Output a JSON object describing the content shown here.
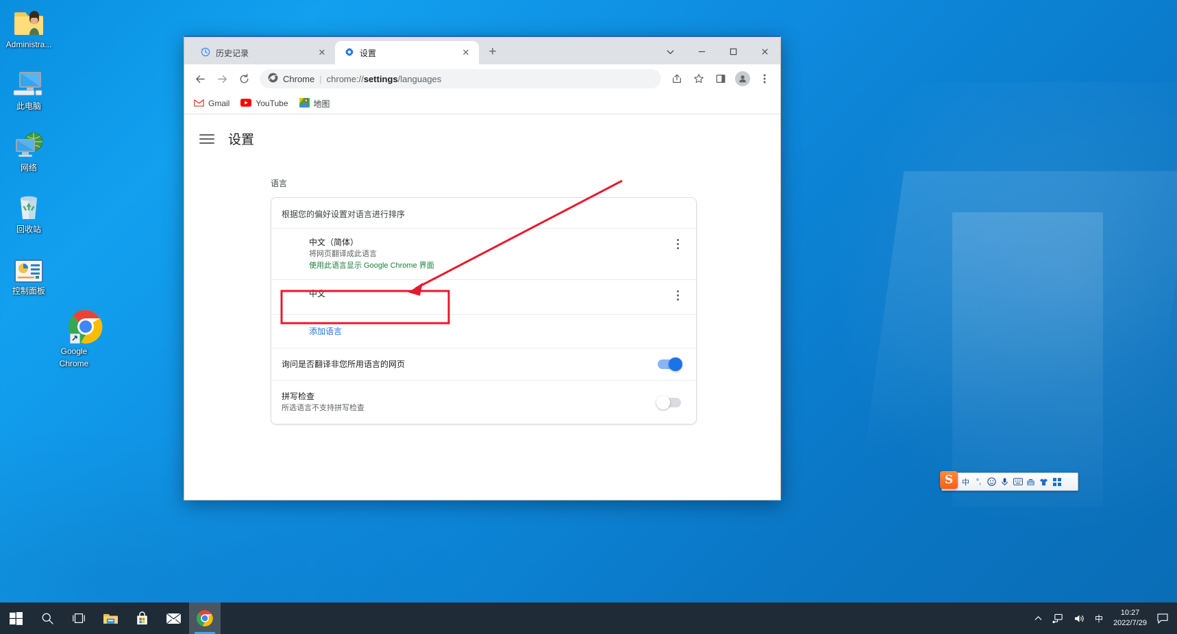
{
  "desktop": {
    "icons": [
      {
        "name": "administrator-folder",
        "label": "Administra..."
      },
      {
        "name": "this-pc",
        "label": "此电脑"
      },
      {
        "name": "network",
        "label": "网络"
      },
      {
        "name": "recycle-bin",
        "label": "回收站"
      },
      {
        "name": "control-panel",
        "label": "控制面板"
      },
      {
        "name": "google-chrome",
        "label": "Google\nChrome",
        "label_line1": "Google",
        "label_line2": "Chrome"
      }
    ]
  },
  "browser": {
    "tabs": [
      {
        "title": "历史记录",
        "icon": "history-icon",
        "active": false,
        "close_label": "✕"
      },
      {
        "title": "设置",
        "icon": "gear-icon",
        "active": true,
        "close_label": "✕"
      }
    ],
    "new_tab_label": "+",
    "window_controls": {
      "tab_search": "tab-search-icon",
      "minimize": "minimize-icon",
      "maximize": "maximize-icon",
      "close": "close-icon"
    },
    "nav": {
      "back": "back-arrow-icon",
      "forward": "forward-arrow-icon",
      "reload": "reload-icon"
    },
    "omnibox": {
      "product": "Chrome",
      "separator": "|",
      "url_prefix": "chrome://",
      "url_bold": "settings",
      "url_suffix": "/languages",
      "full_url": "chrome://settings/languages"
    },
    "toolbar_icons": [
      "share-icon",
      "bookmark-star-icon",
      "side-panel-icon",
      "profile-avatar-icon",
      "chrome-menu-icon"
    ],
    "bookmarks": [
      {
        "label": "Gmail",
        "icon": "gmail-icon"
      },
      {
        "label": "YouTube",
        "icon": "youtube-icon"
      },
      {
        "label": "地图",
        "icon": "maps-icon"
      }
    ]
  },
  "settings": {
    "page_title": "设置",
    "menu_icon": "hamburger-menu-icon",
    "section_label": "语言",
    "card": {
      "heading": "根据您的偏好设置对语言进行排序",
      "languages": [
        {
          "name": "中文（简体）",
          "sub1": "将网页翻译成此语言",
          "sub2": "使用此语言显示 Google Chrome 界面",
          "menu": "more-options-icon"
        },
        {
          "name": "中文",
          "sub1": "",
          "sub2": "",
          "menu": "more-options-icon"
        }
      ],
      "add_language": "添加语言",
      "translate_pref": {
        "title": "询问是否翻译非您所用语言的网页",
        "toggle": "on"
      },
      "spellcheck": {
        "title": "拼写检查",
        "sub": "所选语言不支持拼写检查",
        "toggle": "off"
      }
    }
  },
  "annotation": {
    "color": "#e8192c",
    "highlight_target": "添加语言",
    "shape": "arrow-to-highlight-box"
  },
  "taskbar": {
    "items": [
      {
        "name": "start-button",
        "icon": "windows-logo-icon"
      },
      {
        "name": "search-button",
        "icon": "search-icon"
      },
      {
        "name": "task-view-button",
        "icon": "task-view-icon"
      },
      {
        "name": "file-explorer-button",
        "icon": "folder-icon"
      },
      {
        "name": "microsoft-store-button",
        "icon": "store-bag-icon"
      },
      {
        "name": "mail-button",
        "icon": "envelope-icon"
      },
      {
        "name": "chrome-taskbar-button",
        "icon": "chrome-icon",
        "active": true
      }
    ],
    "tray": {
      "expand": "chevron-up-icon",
      "network": "network-icon",
      "volume": "volume-icon",
      "ime": "中",
      "time": "10:27",
      "date": "2022/7/29",
      "notifications": "notification-icon"
    }
  },
  "ime_bar": {
    "logo": "S",
    "items": [
      {
        "name": "ime-mode",
        "label": "中"
      },
      {
        "name": "ime-punctuation",
        "label": "°,"
      },
      {
        "name": "ime-emoji",
        "label": "☺"
      },
      {
        "name": "ime-voice",
        "label": "🎤"
      },
      {
        "name": "ime-keyboard",
        "label": "⌨"
      },
      {
        "name": "ime-toolbox",
        "label": "🧰"
      },
      {
        "name": "ime-skin",
        "label": "👕"
      },
      {
        "name": "ime-menu",
        "label": "▦"
      }
    ]
  }
}
